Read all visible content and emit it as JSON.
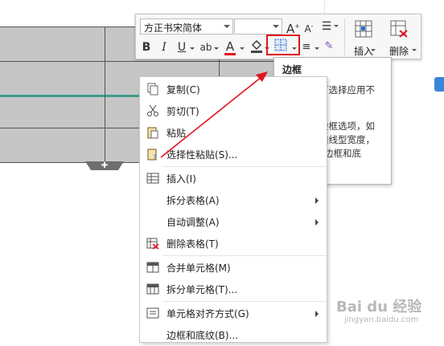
{
  "toolbar": {
    "font_name": "方正书宋简体",
    "font_size": "",
    "insert_label": "插入",
    "delete_label": "删除"
  },
  "tooltip": {
    "title": "边框",
    "para1": "单击箭头可选择应用不同的边框。",
    "para2": "浏览其他边框选项，如线条颜色和线型宽度，可以选择“边框和底纹”选项。"
  },
  "context_menu": {
    "items": [
      {
        "label": "复制(C)",
        "icon": "copy-icon"
      },
      {
        "label": "剪切(T)",
        "icon": "cut-icon"
      },
      {
        "label": "粘贴",
        "icon": "paste-icon"
      },
      {
        "label": "选择性粘贴(S)...",
        "icon": "paste-special-icon"
      },
      {
        "label": "插入(I)",
        "icon": "insert-table-icon"
      },
      {
        "label": "拆分表格(A)",
        "icon": ""
      },
      {
        "label": "自动调整(A)",
        "icon": ""
      },
      {
        "label": "删除表格(T)",
        "icon": "delete-table-icon"
      },
      {
        "label": "合并单元格(M)",
        "icon": "merge-cells-icon"
      },
      {
        "label": "拆分单元格(T)...",
        "icon": "split-cells-icon"
      },
      {
        "label": "单元格对齐方式(G)",
        "icon": "cell-align-icon"
      },
      {
        "label": "边框和底纹(B)...",
        "icon": ""
      }
    ]
  },
  "watermark": {
    "text": "Bai du 经验",
    "sub": "jingyan.baidu.com"
  },
  "colors": {
    "accent_red": "#e0141e",
    "font_color_red": "#e0141e",
    "highlight_blue": "#2b6fd6",
    "table_gray": "#c6c6c6",
    "teal_line": "#3d9e8b"
  }
}
